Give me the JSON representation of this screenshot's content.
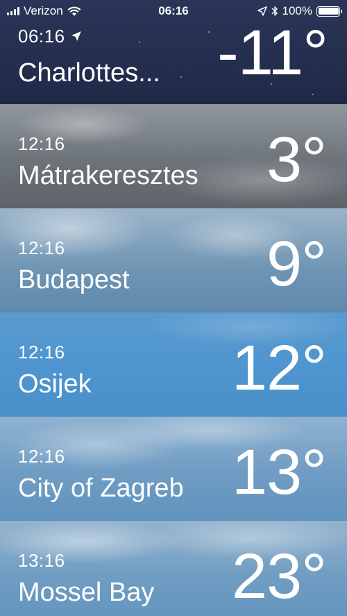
{
  "status_bar": {
    "carrier": "Verizon",
    "time": "06:16",
    "battery": "100%",
    "icons": [
      "signal-icon",
      "wifi-icon",
      "location-arrow-icon",
      "bluetooth-icon",
      "battery-icon"
    ]
  },
  "cities": [
    {
      "time": "06:16",
      "name": "Charlottes...",
      "temp": "-11°",
      "current_location": true
    },
    {
      "time": "12:16",
      "name": "Mátrakeresztes",
      "temp": "3°"
    },
    {
      "time": "12:16",
      "name": "Budapest",
      "temp": "9°"
    },
    {
      "time": "12:16",
      "name": "Osijek",
      "temp": "12°"
    },
    {
      "time": "12:16",
      "name": "City of Zagreb",
      "temp": "13°"
    },
    {
      "time": "13:16",
      "name": "Mossel Bay",
      "temp": "23°"
    }
  ]
}
